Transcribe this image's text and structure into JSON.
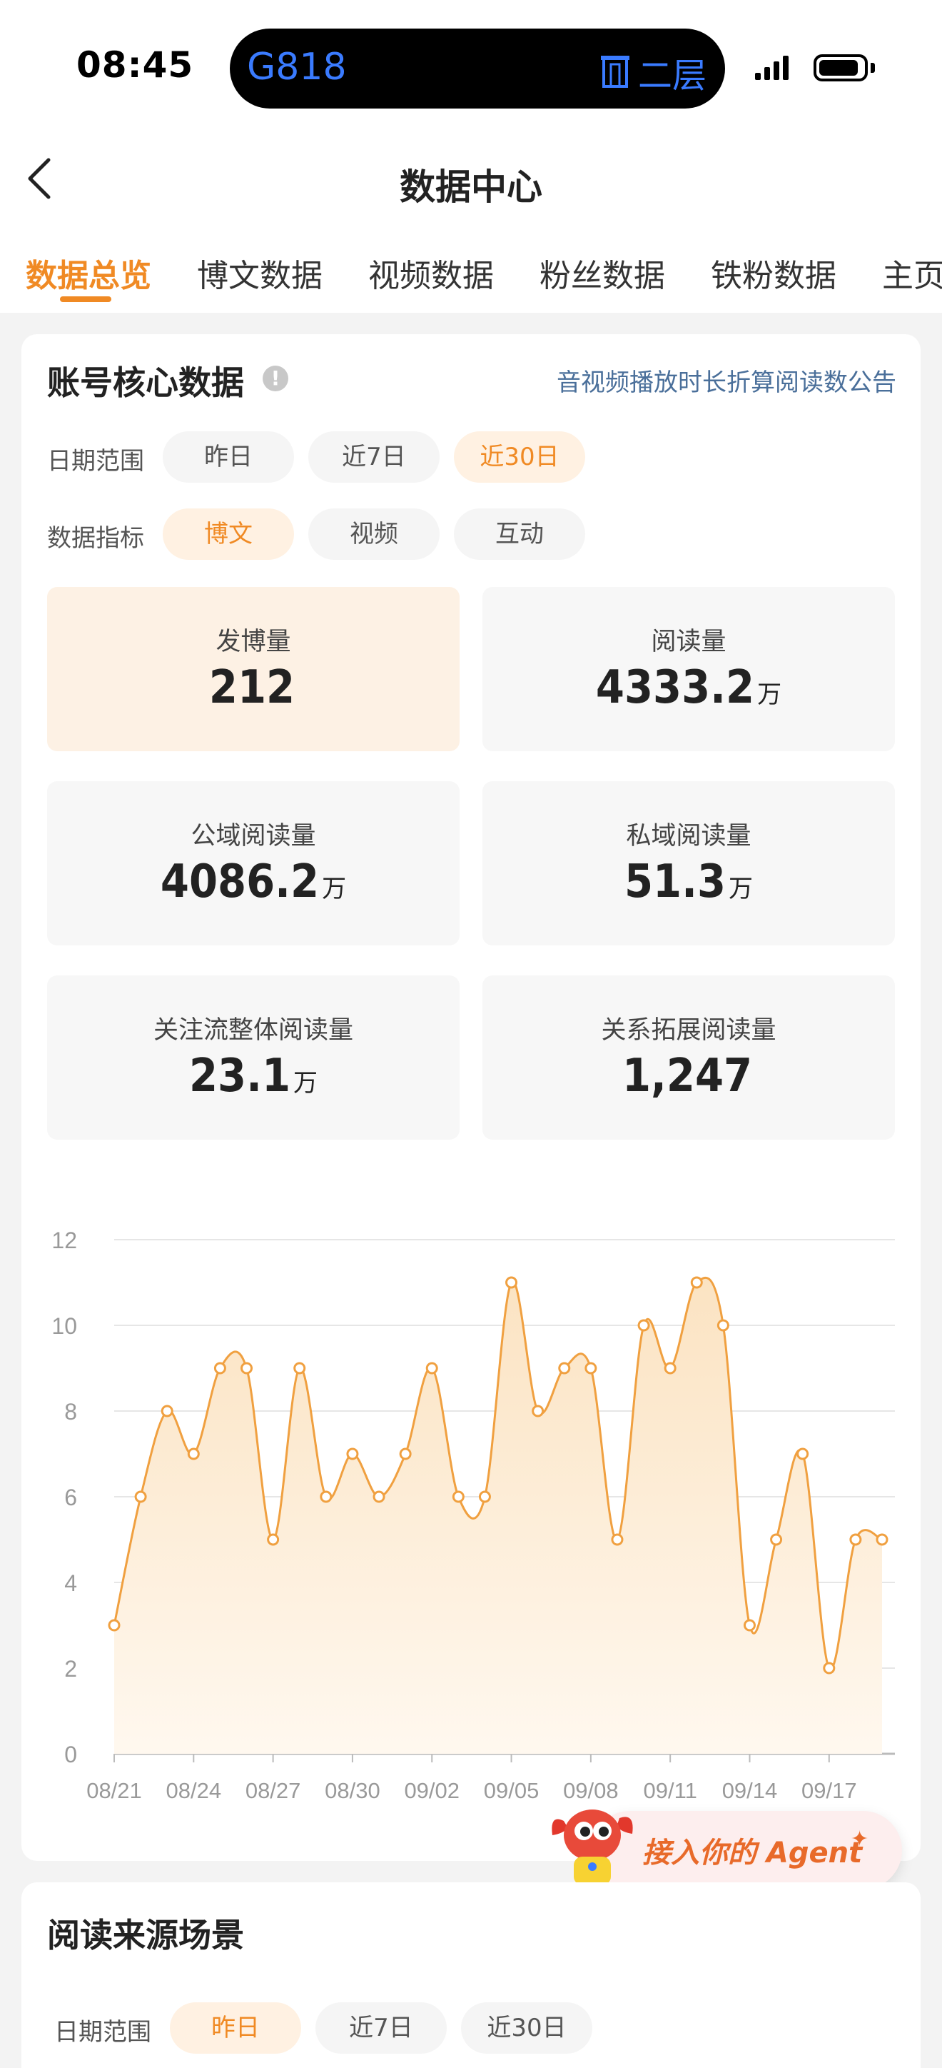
{
  "status_bar": {
    "time": "08:45",
    "train": "G818",
    "gate": "二层"
  },
  "nav": {
    "title": "数据中心"
  },
  "tabs": [
    "数据总览",
    "博文数据",
    "视频数据",
    "粉丝数据",
    "铁粉数据",
    "主页"
  ],
  "active_tab": 0,
  "core": {
    "heading": "账号核心数据",
    "info": "!",
    "notice": "音视频播放时长折算阅读数公告",
    "date_label": "日期范围",
    "date_options": [
      "昨日",
      "近7日",
      "近30日"
    ],
    "date_selected": "近30日",
    "metric_label": "数据指标",
    "metric_options": [
      "博文",
      "视频",
      "互动"
    ],
    "metric_selected": "博文",
    "metrics": [
      {
        "label": "发博量",
        "value": "212",
        "unit": ""
      },
      {
        "label": "阅读量",
        "value": "4333.2",
        "unit": "万"
      },
      {
        "label": "公域阅读量",
        "value": "4086.2",
        "unit": "万"
      },
      {
        "label": "私域阅读量",
        "value": "51.3",
        "unit": "万"
      },
      {
        "label": "关注流整体阅读量",
        "value": "23.1",
        "unit": "万"
      },
      {
        "label": "关系拓展阅读量",
        "value": "1,247",
        "unit": ""
      }
    ]
  },
  "chart_data": {
    "type": "area",
    "title": "",
    "xlabel": "",
    "ylabel": "",
    "ylim": [
      0,
      12
    ],
    "yticks": [
      0,
      2,
      4,
      6,
      8,
      10,
      12
    ],
    "x": [
      "08/21",
      "08/22",
      "08/23",
      "08/24",
      "08/25",
      "08/26",
      "08/27",
      "08/28",
      "08/29",
      "08/30",
      "08/31",
      "09/01",
      "09/02",
      "09/03",
      "09/04",
      "09/05",
      "09/06",
      "09/07",
      "09/08",
      "09/09",
      "09/10",
      "09/11",
      "09/12",
      "09/13",
      "09/14",
      "09/15",
      "09/16",
      "09/17",
      "09/18",
      "09/19"
    ],
    "xtick_labels": [
      "08/21",
      "08/24",
      "08/27",
      "08/30",
      "09/02",
      "09/05",
      "09/08",
      "09/11",
      "09/14",
      "09/17"
    ],
    "series": [
      {
        "values": [
          3,
          6,
          8,
          7,
          9,
          9,
          5,
          9,
          6,
          7,
          6,
          7,
          9,
          6,
          6,
          11,
          8,
          9,
          9,
          5,
          10,
          9,
          11,
          10,
          3,
          5,
          7,
          2,
          5,
          5
        ]
      }
    ],
    "grid": true,
    "colors": {
      "line": "#f0a040",
      "fill_top": "#fbe3c2",
      "fill_bottom": "#fff8ef"
    }
  },
  "agent_banner": {
    "text": "接入你的 Agent"
  },
  "source": {
    "heading": "阅读来源场景",
    "date_label": "日期范围",
    "date_options": [
      "昨日",
      "近7日",
      "近30日"
    ],
    "date_selected": "昨日"
  },
  "colors": {
    "accent": "#f08a24",
    "link": "#4a6f9a"
  }
}
